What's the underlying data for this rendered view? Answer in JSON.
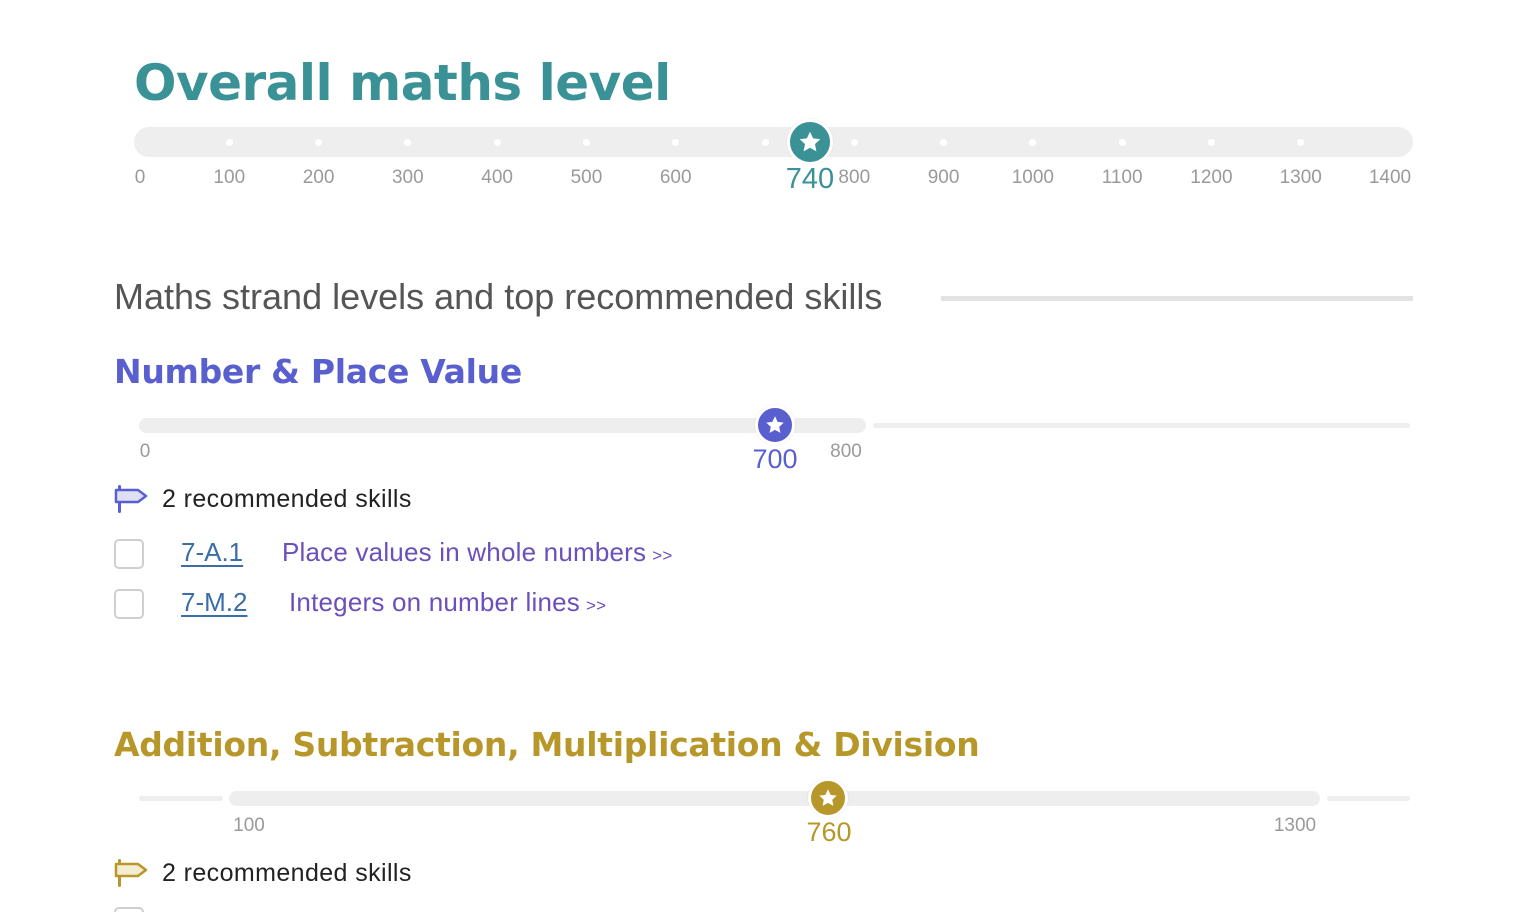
{
  "overall": {
    "title": "Overall maths level",
    "color": "#3a9196",
    "scale_min": 0,
    "scale_max": 1400,
    "ticks": [
      "0",
      "100",
      "200",
      "300",
      "400",
      "500",
      "600",
      "800",
      "900",
      "1000",
      "1100",
      "1200",
      "1300",
      "1400"
    ],
    "value": "740",
    "marker_icon": "star-icon"
  },
  "section": {
    "heading": "Maths strand levels and top recommended skills"
  },
  "strands": [
    {
      "title": "Number & Place Value",
      "color": "#5a5fcf",
      "range_min_label": "0",
      "range_max_label": "800",
      "value": "700",
      "recommended_label": "2 recommended skills",
      "skills": [
        {
          "code": "7-A.1",
          "name": "Place values in whole numbers",
          "arrows": ">>"
        },
        {
          "code": "7-M.2",
          "name": "Integers on number lines",
          "arrows": ">>"
        }
      ]
    },
    {
      "title": "Addition, Subtraction, Multiplication & Division",
      "color": "#b8972a",
      "range_min_label": "100",
      "range_max_label": "1300",
      "value": "760",
      "recommended_label": "2 recommended skills"
    }
  ]
}
